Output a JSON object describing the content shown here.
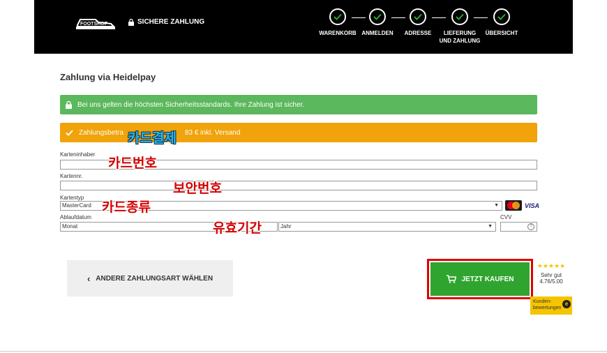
{
  "header": {
    "logo_text": "FOOTSHOP",
    "secure_label": "SICHERE ZAHLUNG",
    "steps": [
      {
        "label": "WARENKORB"
      },
      {
        "label": "ANMELDEN"
      },
      {
        "label": "ADRESSE"
      },
      {
        "label": "LIEFERUNG\nUND ZAHLUNG"
      },
      {
        "label": "ÜBERSICHT"
      }
    ]
  },
  "main": {
    "heading": "Zahlung via Heidelpay",
    "security_notice": "Bei uns gelten die höchsten Sicherheitsstandards. Ihre Zahlung ist sicher.",
    "amount_notice_prefix": "Zahlungsbetra",
    "amount_notice_suffix": "83 € inkl. Versand"
  },
  "form": {
    "holder_label": "Karteninhaber",
    "holder_value": "",
    "number_label": "Kartennr.",
    "number_value": "",
    "type_label": "Kartentyp",
    "type_value": "MasterCard",
    "expiry_label": "Ablaufdatum",
    "month_value": "Monat",
    "year_value": "Jahr",
    "cvv_label": "CVV",
    "cvv_value": "",
    "card_brands": [
      "mastercard",
      "VISA"
    ]
  },
  "actions": {
    "back_label": "ANDERE ZAHLUNGSART WÄHLEN",
    "buy_label": "JETZT KAUFEN"
  },
  "rating": {
    "stars": "★★★★★",
    "text": "Sehr gut",
    "score": "4.76/5.00",
    "badge_line1": "Kunden-",
    "badge_line2": "bewertungen"
  },
  "annotations": {
    "card_payment": "카드결제",
    "card_number": "카드번호",
    "security_code": "보안번호",
    "card_type": "카드종류",
    "expiry": "유효기간"
  },
  "colors": {
    "header_bg": "#000000",
    "success_green": "#5cb85c",
    "warning_orange": "#f0a30a",
    "buy_green": "#2fa52f",
    "highlight_red": "#e00000"
  }
}
